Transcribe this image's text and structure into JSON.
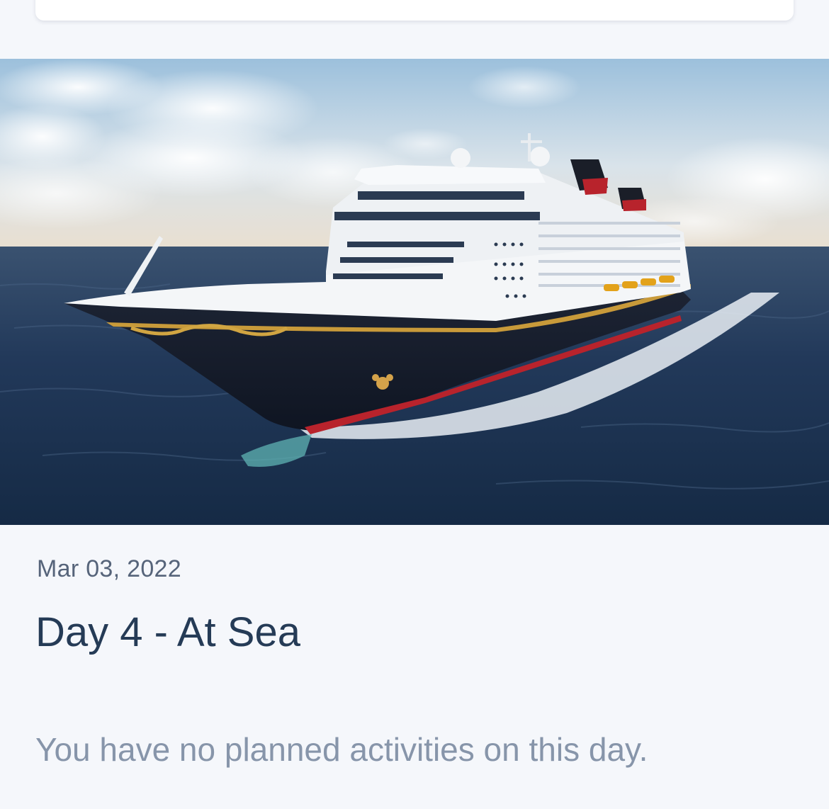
{
  "itinerary_day": {
    "date": "Mar 03, 2022",
    "title": "Day 4 - At Sea",
    "empty_message": "You have no planned activities on this day."
  },
  "hero_image": {
    "subject": "cruise-ship-at-sea"
  },
  "colors": {
    "background": "#f5f7fb",
    "title": "#253b56",
    "date": "#56647a",
    "empty_message": "#8795aa"
  }
}
